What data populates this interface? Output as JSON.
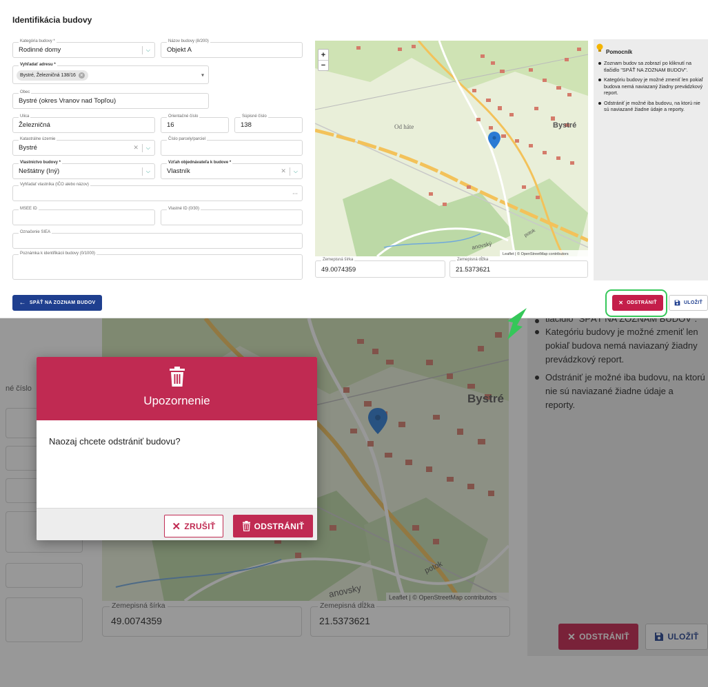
{
  "panel": {
    "title": "Identifikácia budovy",
    "fields": {
      "building_category": {
        "label": "Kategória budovy *",
        "value": "Rodinné domy"
      },
      "building_name": {
        "label": "Názov budovy (8/200)",
        "value": "Objekt A"
      },
      "address_search": {
        "label": "Vyhľadať adresu *",
        "value": "Bystré, Železničná 138/16"
      },
      "municipality": {
        "label": "Obec",
        "value": "Bystré (okres Vranov nad Topľou)"
      },
      "street": {
        "label": "Ulica",
        "value": "Železničná"
      },
      "orientation_number": {
        "label": "Orientačné číslo",
        "value": "16"
      },
      "register_number": {
        "label": "Súpisné číslo",
        "value": "138"
      },
      "cadastral_area": {
        "label": "Katastrálne územie",
        "value": "Bystré"
      },
      "parcel_number": {
        "label": "Číslo parcely/parciel",
        "value": ""
      },
      "ownership": {
        "label": "Vlastníctvo budovy *",
        "value": "Neštátny (Iný)"
      },
      "relation": {
        "label": "Vzťah objednávateľa k budove *",
        "value": "Vlastník"
      },
      "owner_search": {
        "label": "Vyhľadať vlastníka (IČO alebo názov)",
        "value": ""
      },
      "msee_id": {
        "label": "MSEE ID",
        "value": ""
      },
      "own_id": {
        "label": "Vlastné ID (0/30)",
        "value": ""
      },
      "siea": {
        "label": "Označenie SIEA",
        "value": ""
      },
      "note": {
        "label": "Poznámka k identifikácii budovy (0/1000)",
        "value": ""
      },
      "latitude": {
        "label": "Zemepisná šírka",
        "value": "49.0074359"
      },
      "longitude": {
        "label": "Zemepisná dĺžka",
        "value": "21.5373621"
      }
    },
    "map": {
      "zoom_in": "+",
      "zoom_out": "−",
      "label_od_hate": "Od háte",
      "label_town": "Bystré",
      "label_potok": "potok",
      "label_vransky": "anovský",
      "attribution": "Leaflet | © OpenStreetMap contributors"
    },
    "helper": {
      "title": "Pomocník",
      "items": [
        "Zoznam budov sa zobrazí po kliknutí na tlačidlo \"SPÄŤ NA ZOZNAM BUDOV\".",
        "Kategóriu budovy je možné zmeniť len pokiaľ budova nemá naviazaný žiadny prevádzkový report.",
        "Odstrániť je možné iba budovu, na ktorú nie sú naviazané žiadne údaje a reporty."
      ]
    },
    "buttons": {
      "back": "SPÄŤ NA ZOZNAM BUDOV",
      "delete": "ODSTRÁNIŤ",
      "save": "ULOŽIŤ"
    }
  },
  "background": {
    "label_fragment": "né číslo",
    "helper_cut": "tlačidlo \"SPÄŤ NA ZOZNAM BUDOV\".",
    "helper_items": [
      "Kategóriu budovy je možné zmeniť len pokiaľ budova nemá naviazaný žiadny prevádzkový report.",
      "Odstrániť je možné iba budovu, na ktorú nie sú naviazané žiadne údaje a reporty."
    ],
    "latitude": {
      "label": "Zemepisná šírka",
      "value": "49.0074359"
    },
    "longitude": {
      "label": "Zemepisná dĺžka",
      "value": "21.5373621"
    },
    "map_town": "Bystré",
    "map_potok": "potok",
    "map_vransky": "anovsky",
    "attribution": "Leaflet | © OpenStreetMap contributors",
    "delete": "ODSTRÁNIŤ",
    "save": "ULOŽIŤ"
  },
  "modal": {
    "title": "Upozornenie",
    "message": "Naozaj chcete odstrániť budovu?",
    "cancel": "ZRUŠIŤ",
    "confirm": "ODSTRÁNIŤ"
  },
  "colors": {
    "primary": "#1f3f8f",
    "danger": "#c02a52",
    "highlight": "#35c759"
  }
}
